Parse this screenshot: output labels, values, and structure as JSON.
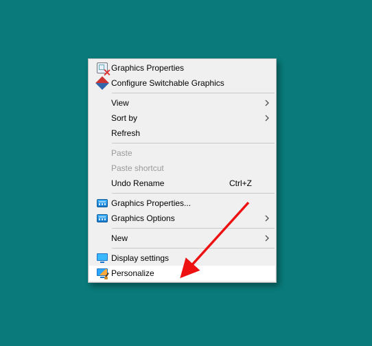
{
  "menu": {
    "items": [
      {
        "label": "Graphics Properties"
      },
      {
        "label": "Configure Switchable Graphics"
      },
      {
        "label": "View"
      },
      {
        "label": "Sort by"
      },
      {
        "label": "Refresh"
      },
      {
        "label": "Paste"
      },
      {
        "label": "Paste shortcut"
      },
      {
        "label": "Undo Rename",
        "shortcut": "Ctrl+Z"
      },
      {
        "label": "Graphics Properties..."
      },
      {
        "label": "Graphics Options"
      },
      {
        "label": "New"
      },
      {
        "label": "Display settings"
      },
      {
        "label": "Personalize"
      }
    ]
  }
}
